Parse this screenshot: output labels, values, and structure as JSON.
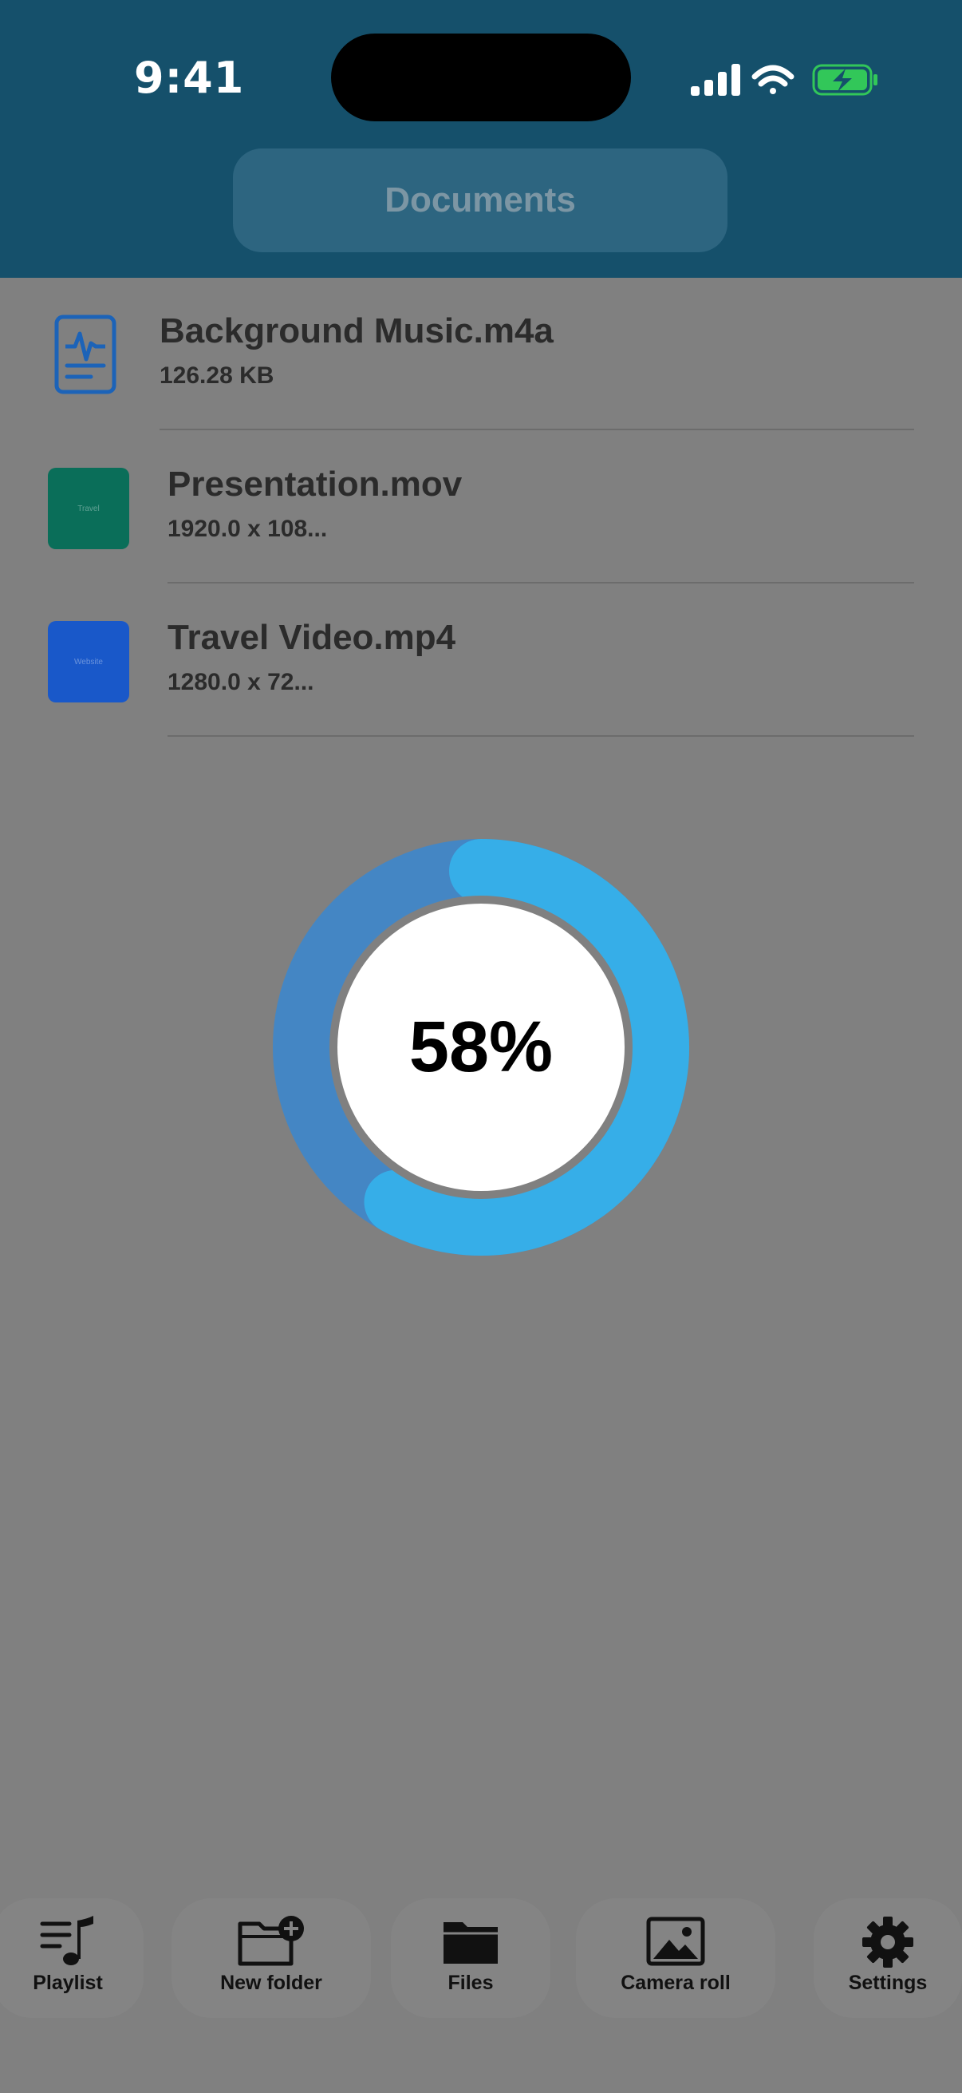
{
  "status_bar": {
    "time": "9:41",
    "icons": [
      "cellular-signal-icon",
      "wifi-icon",
      "battery-charging-icon"
    ],
    "battery_color": "#32c759"
  },
  "header": {
    "title": "Documents",
    "background": "#15506b"
  },
  "files": [
    {
      "name": "Background Music.m4a",
      "meta": "126.28 KB",
      "icon": "audio-file-icon"
    },
    {
      "name": "Presentation.mov",
      "meta": "1920.0 x 108...",
      "thumb_text": "Travel",
      "thumb_color": "#0a6e59"
    },
    {
      "name": "Travel Video.mp4",
      "meta": "1280.0 x 72...",
      "thumb_text": "Website",
      "thumb_color": "#1958c9"
    }
  ],
  "progress": {
    "label": "58%",
    "value": 0.58,
    "track_color": "#4486c4",
    "fill_color": "#36aee8"
  },
  "tabbar": {
    "items": [
      {
        "label": "Playlist",
        "icon": "playlist-icon"
      },
      {
        "label": "New folder",
        "icon": "new-folder-icon"
      },
      {
        "label": "Files",
        "icon": "folder-icon"
      },
      {
        "label": "Camera roll",
        "icon": "photo-icon"
      },
      {
        "label": "Settings",
        "icon": "gear-icon"
      }
    ]
  }
}
